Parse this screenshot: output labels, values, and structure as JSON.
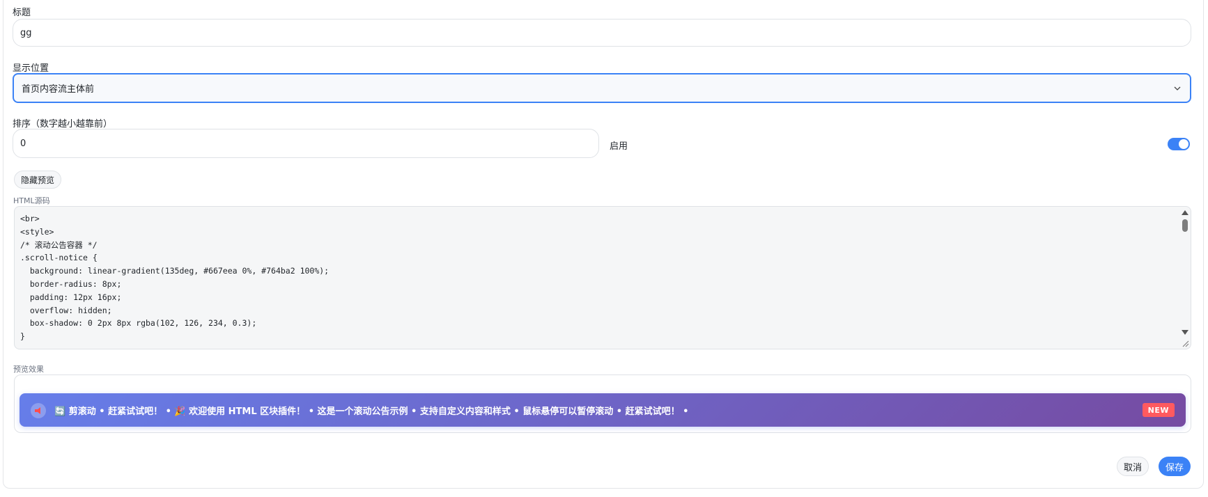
{
  "form": {
    "title_label": "标题",
    "title_value": "gg",
    "position_label": "显示位置",
    "position_value": "首页内容流主体前",
    "order_label": "排序（数字越小越靠前）",
    "order_value": "0",
    "enabled_label": "启用",
    "enabled": true,
    "toggle_preview_label": "隐藏预览",
    "html_source_label": "HTML源码",
    "html_source": "<br>\n<style>\n/* 滚动公告容器 */\n.scroll-notice {\n  background: linear-gradient(135deg, #667eea 0%, #764ba2 100%);\n  border-radius: 8px;\n  padding: 12px 16px;\n  overflow: hidden;\n  box-shadow: 0 2px 8px rgba(102, 126, 234, 0.3);\n}",
    "preview_label": "预览效果"
  },
  "preview": {
    "notice_text": "🔄 剪滚动 • 赶紧试试吧！ • 🎉 欢迎使用 HTML 区块插件！ • 这是一个滚动公告示例 • 支持自定义内容和样式 • 鼠标悬停可以暂停滚动 • 赶紧试试吧！ •",
    "badge": "NEW",
    "gradient_start": "#667eea",
    "gradient_end": "#764ba2"
  },
  "actions": {
    "cancel_label": "取消",
    "save_label": "保存"
  },
  "colors": {
    "accent": "#3b82f6",
    "badge_bg": "#ff5a5f"
  }
}
